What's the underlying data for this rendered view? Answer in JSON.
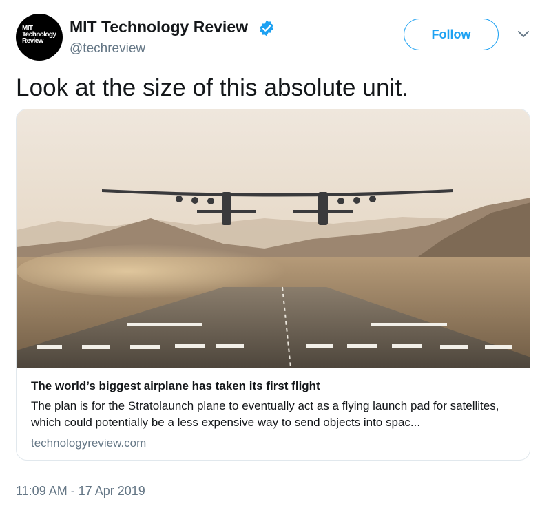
{
  "author": {
    "name": "MIT Technology Review",
    "handle": "@techreview",
    "avatar_text": [
      "MIT",
      "Technology",
      "Review"
    ],
    "verified_icon": "verified-badge-icon"
  },
  "follow_button": {
    "label": "Follow"
  },
  "menu_icon": "chevron-down-icon",
  "tweet": {
    "text": "Look at the size of this absolute unit."
  },
  "card": {
    "image_icon": "airplane-takeoff-photo",
    "title": "The world’s biggest airplane has taken its first flight",
    "description": "The plan is for the Stratolaunch plane to eventually act as a flying launch pad for satellites, which could potentially be a less expensive way to send objects into spac...",
    "domain": "technologyreview.com"
  },
  "timestamp": "11:09 AM - 17 Apr 2019",
  "colors": {
    "accent": "#1da1f2",
    "text": "#14171a",
    "muted": "#657786",
    "border": "#e1e8ed"
  }
}
